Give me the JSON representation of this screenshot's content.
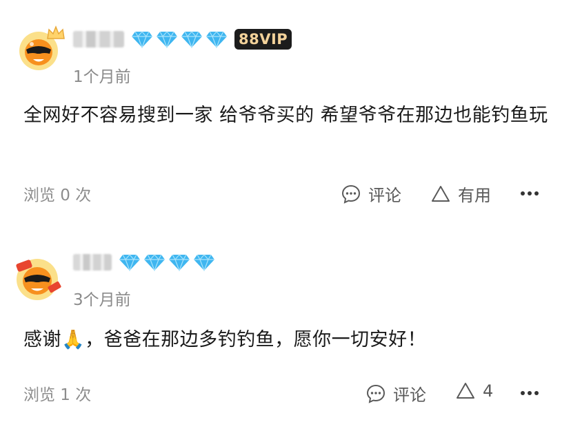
{
  "comments": [
    {
      "diamond_count": 4,
      "vip_badge": "88VIP",
      "time": "1个月前",
      "content": "全网好不容易搜到一家 给爷爷买的 希望爷爷在那边也能钓鱼玩",
      "views": "浏览 0 次",
      "comment_label": "评论",
      "useful_label": "有用",
      "more_icon": "more-dots-icon"
    },
    {
      "diamond_count": 4,
      "time": "3个月前",
      "content": "感谢🙏，爸爸在那边多钓钓鱼，愿你一切安好！",
      "views": "浏览 1 次",
      "comment_label": "评论",
      "useful_label": "4",
      "more_icon": "more-dots-icon"
    }
  ],
  "colors": {
    "diamond": "#3fb6f0",
    "vip_bg": "#1c1c1c",
    "vip_text": "#f3d29a",
    "meta_text": "#8a8a8a",
    "avatar_orange": "#f7901e"
  }
}
